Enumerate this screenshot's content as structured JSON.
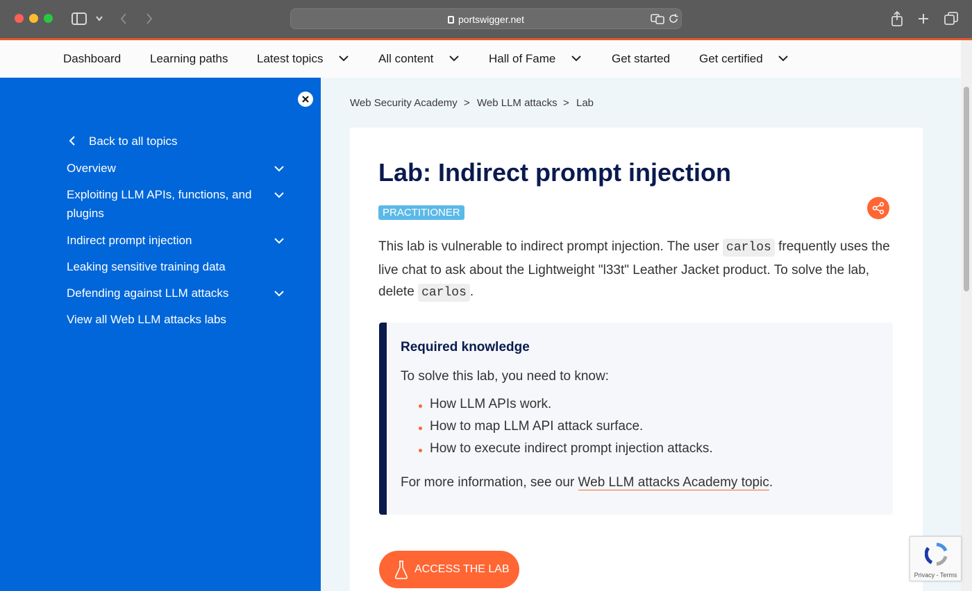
{
  "browser": {
    "url": "portswigger.net"
  },
  "topnav": {
    "items": [
      {
        "label": "Dashboard"
      },
      {
        "label": "Learning paths"
      },
      {
        "label": "Latest topics"
      },
      {
        "label": "All content"
      },
      {
        "label": "Hall of Fame"
      },
      {
        "label": "Get started"
      },
      {
        "label": "Get certified"
      }
    ]
  },
  "sidebar": {
    "back": "Back to all topics",
    "items": [
      {
        "label": "Overview"
      },
      {
        "label": "Exploiting LLM APIs, functions, and plugins"
      },
      {
        "label": "Indirect prompt injection"
      },
      {
        "label": "Leaking sensitive training data"
      },
      {
        "label": "Defending against LLM attacks"
      },
      {
        "label": "View all Web LLM attacks labs"
      }
    ]
  },
  "breadcrumb": {
    "items": [
      "Web Security Academy",
      "Web LLM attacks",
      "Lab"
    ],
    "separator": ">"
  },
  "lab": {
    "title": "Lab: Indirect prompt injection",
    "level": "PRACTITIONER",
    "intro": {
      "part1": "This lab is vulnerable to indirect prompt injection. The user",
      "user": "carlos",
      "part2": "frequently uses the live chat to ask about the Lightweight \"l33t\" Leather Jacket product. To solve the lab, delete",
      "end": "."
    },
    "required_knowledge": {
      "heading": "Required knowledge",
      "lead": "To solve this lab, you need to know:",
      "bullets": [
        "How LLM APIs work.",
        "How to map LLM API attack surface.",
        "How to execute indirect prompt injection attacks."
      ],
      "more_prefix": "For more information, see our",
      "more_link": "Web LLM attacks Academy topic",
      "more_suffix": "."
    },
    "cta": "ACCESS THE LAB"
  },
  "recaptcha": {
    "links": "Privacy - Terms"
  },
  "colors": {
    "sidebar": "#0066d9",
    "accent": "#ff6633",
    "title": "#0a1a4f",
    "badge": "#5ab9e8"
  }
}
